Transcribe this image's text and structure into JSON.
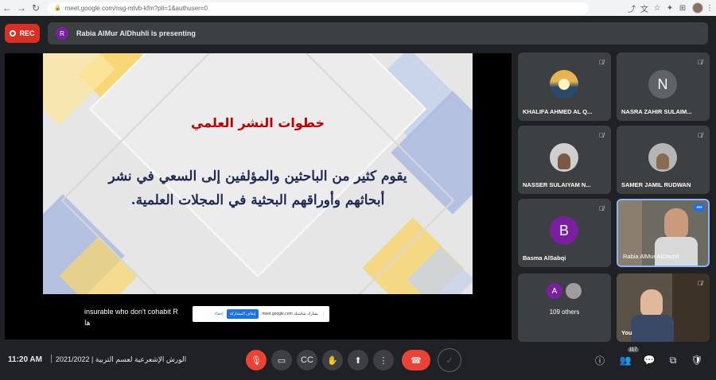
{
  "browser": {
    "url": "meet.google.com/nsg-mtvb-kfm?pli=1&authuser=0",
    "icons": [
      "back-icon",
      "forward-icon",
      "reload-icon",
      "lock-icon",
      "share-page-icon",
      "translate-icon",
      "star-icon",
      "extension-icon",
      "profile-icon"
    ]
  },
  "meeting": {
    "rec_label": "REC",
    "presenter_initial": "R",
    "presenting_text": "Rabia AlMur AlDhuhli is presenting",
    "time": "11:20 AM",
    "separator": "|",
    "title": "2021/2022 | الورش الإشعرعية لعسم التربية"
  },
  "slide": {
    "title": "خطوات النشر العلمي",
    "body": "يقوم كثير من الباحثين والمؤلفين إلى السعي في نشر أبحاثهم وأوراقهم البحثية في المجلات العلمية."
  },
  "captions": {
    "line1": "insurable who don't cohabit R",
    "line2": "ها"
  },
  "share_bar": {
    "text": "يشارك شاشتك meet.google.com",
    "stop_label": "إيقاف المشاركة",
    "hide_label": "إخفاء"
  },
  "participants": [
    {
      "name": "KHALIFA AHMED AL Q...",
      "initial": "",
      "avatar_color": "#5f8fa8"
    },
    {
      "name": "NASRA ZAHIR SULAIM...",
      "initial": "N",
      "avatar_color": "#5f6368"
    },
    {
      "name": "NASSER SULAIYAM N...",
      "initial": "",
      "avatar_color": "#9e9e9e"
    },
    {
      "name": "SAMER JAMIL RUDWAN",
      "initial": "",
      "avatar_color": "#8d8d8d"
    },
    {
      "name": "Basma AlSabqi",
      "initial": "B",
      "avatar_color": "#7b1fa2"
    },
    {
      "name": "Rabia AlMur AlDhuhli",
      "initial": "",
      "avatar_color": "#6d6a62"
    }
  ],
  "others": {
    "initial": "A",
    "text": "109 others"
  },
  "self_label": "You",
  "people_count": "117",
  "colors": {
    "background": "#202124",
    "tile": "#3c4043",
    "danger": "#ea4335",
    "accent": "#1a73e8"
  }
}
